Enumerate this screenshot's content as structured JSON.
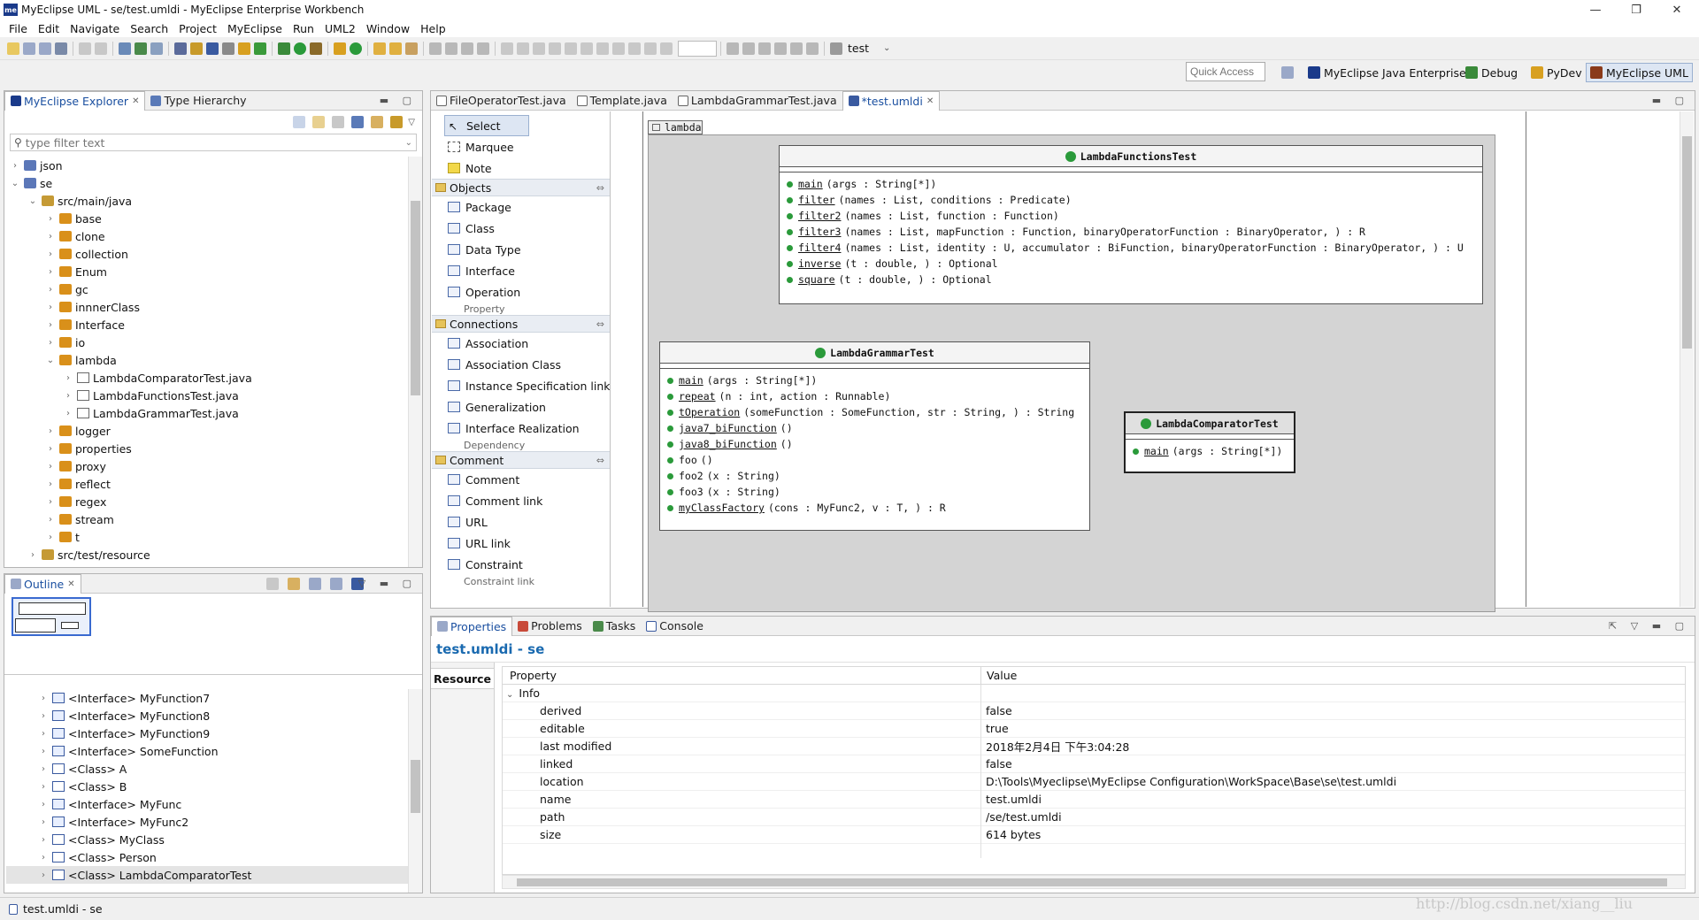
{
  "window": {
    "title": "MyEclipse UML - se/test.umldi - MyEclipse Enterprise Workbench",
    "logo": "me"
  },
  "window_controls": {
    "minimize": "—",
    "maximize": "❐",
    "close": "✕"
  },
  "menu": [
    "File",
    "Edit",
    "Navigate",
    "Search",
    "Project",
    "MyEclipse",
    "Run",
    "UML2",
    "Window",
    "Help"
  ],
  "toolbar": {
    "run_config": "test"
  },
  "quick_access": {
    "placeholder": "Quick Access"
  },
  "perspectives": [
    {
      "label": "MyEclipse Java Enterprise",
      "icon": "myeclipse-icon",
      "color": "#1a3a8a"
    },
    {
      "label": "Debug",
      "icon": "debug-icon",
      "color": "#3a8a3a"
    },
    {
      "label": "PyDev",
      "icon": "pydev-icon",
      "color": "#d8a020"
    },
    {
      "label": "MyEclipse UML",
      "icon": "uml-icon",
      "color": "#8a3a1a",
      "active": true
    }
  ],
  "explorer": {
    "tabs": [
      {
        "label": "MyEclipse Explorer",
        "active": true
      },
      {
        "label": "Type Hierarchy"
      }
    ],
    "filter_placeholder": "type filter text",
    "tree": [
      {
        "label": "json",
        "indent": 0,
        "arrow": "›",
        "icon": "proj"
      },
      {
        "label": "se",
        "indent": 0,
        "arrow": "⌄",
        "icon": "proj"
      },
      {
        "label": "src/main/java",
        "indent": 1,
        "arrow": "⌄",
        "icon": "src"
      },
      {
        "label": "base",
        "indent": 2,
        "arrow": "›",
        "icon": "pkg"
      },
      {
        "label": "clone",
        "indent": 2,
        "arrow": "›",
        "icon": "pkg"
      },
      {
        "label": "collection",
        "indent": 2,
        "arrow": "›",
        "icon": "pkg"
      },
      {
        "label": "Enum",
        "indent": 2,
        "arrow": "›",
        "icon": "pkg"
      },
      {
        "label": "gc",
        "indent": 2,
        "arrow": "›",
        "icon": "pkg"
      },
      {
        "label": "innnerClass",
        "indent": 2,
        "arrow": "›",
        "icon": "pkg"
      },
      {
        "label": "Interface",
        "indent": 2,
        "arrow": "›",
        "icon": "pkg"
      },
      {
        "label": "io",
        "indent": 2,
        "arrow": "›",
        "icon": "pkg"
      },
      {
        "label": "lambda",
        "indent": 2,
        "arrow": "⌄",
        "icon": "pkg"
      },
      {
        "label": "LambdaComparatorTest.java",
        "indent": 3,
        "arrow": "›",
        "icon": "file"
      },
      {
        "label": "LambdaFunctionsTest.java",
        "indent": 3,
        "arrow": "›",
        "icon": "file"
      },
      {
        "label": "LambdaGrammarTest.java",
        "indent": 3,
        "arrow": "›",
        "icon": "file"
      },
      {
        "label": "logger",
        "indent": 2,
        "arrow": "›",
        "icon": "pkg"
      },
      {
        "label": "properties",
        "indent": 2,
        "arrow": "›",
        "icon": "pkg"
      },
      {
        "label": "proxy",
        "indent": 2,
        "arrow": "›",
        "icon": "pkg"
      },
      {
        "label": "reflect",
        "indent": 2,
        "arrow": "›",
        "icon": "pkg"
      },
      {
        "label": "regex",
        "indent": 2,
        "arrow": "›",
        "icon": "pkg"
      },
      {
        "label": "stream",
        "indent": 2,
        "arrow": "›",
        "icon": "pkg"
      },
      {
        "label": "t",
        "indent": 2,
        "arrow": "›",
        "icon": "pkg"
      },
      {
        "label": "src/test/resource",
        "indent": 1,
        "arrow": "›",
        "icon": "src"
      }
    ]
  },
  "outline": {
    "tab": "Outline",
    "items": [
      {
        "label": "<Interface> MyFunction7",
        "icon": "iface"
      },
      {
        "label": "<Interface> MyFunction8",
        "icon": "iface"
      },
      {
        "label": "<Interface> MyFunction9",
        "icon": "iface"
      },
      {
        "label": "<Interface> SomeFunction",
        "icon": "iface"
      },
      {
        "label": "<Class> A",
        "icon": "class"
      },
      {
        "label": "<Class> B",
        "icon": "class"
      },
      {
        "label": "<Interface> MyFunc",
        "icon": "iface"
      },
      {
        "label": "<Interface> MyFunc2",
        "icon": "iface"
      },
      {
        "label": "<Class> MyClass",
        "icon": "class"
      },
      {
        "label": "<Class> Person",
        "icon": "class"
      },
      {
        "label": "<Class> LambdaComparatorTest",
        "icon": "class",
        "selected": true
      }
    ]
  },
  "editor_tabs": [
    {
      "label": "FileOperatorTest.java"
    },
    {
      "label": "Template.java"
    },
    {
      "label": "LambdaGrammarTest.java"
    },
    {
      "label": "*test.umldi",
      "active": true
    }
  ],
  "palette": {
    "top": [
      {
        "label": "Select",
        "icon": "cursor",
        "selected": true
      },
      {
        "label": "Marquee",
        "icon": "marquee"
      },
      {
        "label": "Note",
        "icon": "note"
      }
    ],
    "sections": [
      {
        "title": "Objects",
        "items": [
          "Package",
          "Class",
          "Data Type",
          "Interface",
          "Operation"
        ],
        "more": "Property"
      },
      {
        "title": "Connections",
        "items": [
          "Association",
          "Association Class",
          "Instance Specification link",
          "Generalization",
          "Interface Realization"
        ],
        "more": "Dependency"
      },
      {
        "title": "Comment",
        "items": [
          "Comment",
          "Comment link",
          "URL",
          "URL link",
          "Constraint"
        ],
        "more": "Constraint link"
      }
    ]
  },
  "diagram": {
    "package": "lambda",
    "classes": [
      {
        "name": "LambdaFunctionsTest",
        "ops": [
          {
            "name": "main",
            "sig": "(args : String[*])"
          },
          {
            "name": "filter",
            "sig": "(names : List, conditions : Predicate)"
          },
          {
            "name": "filter2",
            "sig": "(names : List, function : Function)"
          },
          {
            "name": "filter3",
            "sig": "(names : List, mapFunction : Function, binaryOperatorFunction : BinaryOperator, ) : R"
          },
          {
            "name": "filter4",
            "sig": "(names : List, identity : U, accumulator : BiFunction, binaryOperatorFunction : BinaryOperator, ) : U"
          },
          {
            "name": "inverse",
            "sig": "(t : double, ) : Optional"
          },
          {
            "name": "square",
            "sig": "(t : double, ) : Optional"
          }
        ]
      },
      {
        "name": "LambdaGrammarTest",
        "ops": [
          {
            "name": "main",
            "sig": "(args : String[*])",
            "static": true
          },
          {
            "name": "repeat",
            "sig": "(n : int, action : Runnable)",
            "static": true
          },
          {
            "name": "tOperation",
            "sig": "(someFunction : SomeFunction, str : String, ) : String",
            "static": true
          },
          {
            "name": "java7_biFunction",
            "sig": "()",
            "static": true
          },
          {
            "name": "java8_biFunction",
            "sig": "()",
            "static": true
          },
          {
            "name": "foo",
            "sig": "()"
          },
          {
            "name": "foo2",
            "sig": "(x : String)"
          },
          {
            "name": "foo3",
            "sig": "(x : String)"
          },
          {
            "name": "myClassFactory",
            "sig": "(cons : MyFunc2, v : T, ) : R",
            "static": true
          }
        ]
      },
      {
        "name": "LambdaComparatorTest",
        "ops": [
          {
            "name": "main",
            "sig": "(args : String[*])",
            "static": true
          }
        ]
      }
    ]
  },
  "bottom_tabs": [
    {
      "label": "Properties",
      "active": true
    },
    {
      "label": "Problems"
    },
    {
      "label": "Tasks"
    },
    {
      "label": "Console"
    }
  ],
  "properties": {
    "title": "test.umldi - se",
    "side_tab": "Resource",
    "headers": {
      "property": "Property",
      "value": "Value"
    },
    "group": "Info",
    "rows": [
      {
        "key": "derived",
        "value": "false"
      },
      {
        "key": "editable",
        "value": "true"
      },
      {
        "key": "last modified",
        "value": "2018年2月4日 下午3:04:28"
      },
      {
        "key": "linked",
        "value": "false"
      },
      {
        "key": "location",
        "value": "D:\\Tools\\Myeclipse\\MyEclipse Configuration\\WorkSpace\\Base\\se\\test.umldi"
      },
      {
        "key": "name",
        "value": "test.umldi"
      },
      {
        "key": "path",
        "value": "/se/test.umldi"
      },
      {
        "key": "size",
        "value": "614  bytes"
      }
    ]
  },
  "status": {
    "text": "test.umldi - se"
  },
  "watermark": "http://blog.csdn.net/xiang__liu",
  "colors": {
    "accent": "#1a4fa0",
    "class_icon": "#2a9a3a"
  }
}
